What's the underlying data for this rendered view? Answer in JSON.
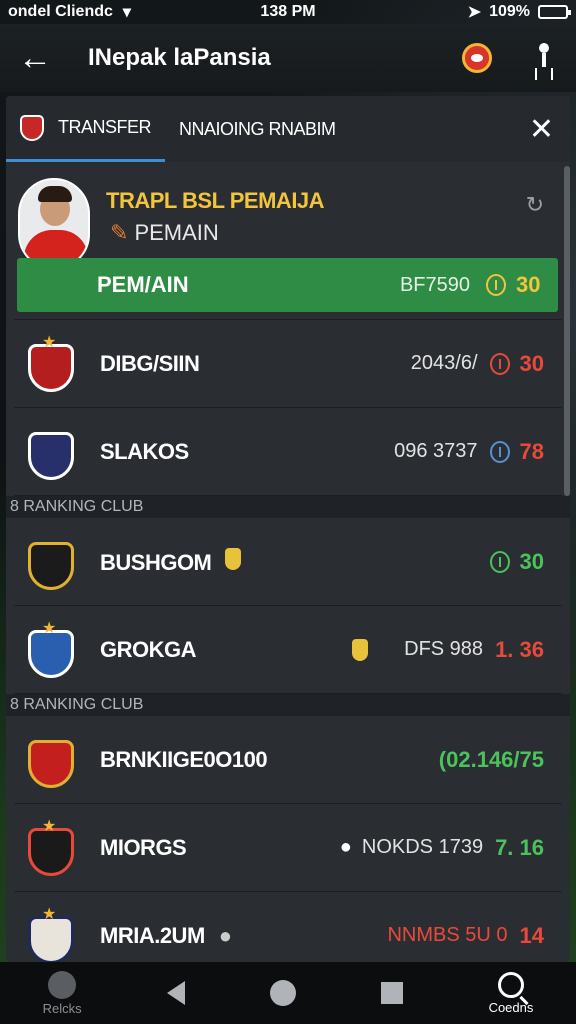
{
  "status": {
    "carrier": "ondel Cliendc",
    "time": "138 PM",
    "battery": "109%"
  },
  "appbar": {
    "title": "INepak laPansia"
  },
  "tabs": [
    {
      "label": "TRANSFER"
    },
    {
      "label": "NNAIOING RNABIM"
    }
  ],
  "profile": {
    "title": "TRAPL BSL PEMAIJA",
    "subtitle": "PEMAIN",
    "highlight": {
      "name": "PEM/AIN",
      "code": "BF7590",
      "value": "30"
    }
  },
  "rows_top": [
    {
      "name": "DIBG/SIIN",
      "code": "2043/6/",
      "value": "30",
      "color": "#e84a3a"
    },
    {
      "name": "SLAKOS",
      "code": "096 3737",
      "value": "78",
      "color": "#e84a3a"
    }
  ],
  "section1": "8 RANKING CLUB",
  "rows_mid": [
    {
      "name": "BUSHGOM",
      "code": "",
      "value": "30",
      "color": "#4cc35a"
    },
    {
      "name": "GROKGA",
      "code": "DFS 988",
      "value": "1. 36",
      "color": "#e84a3a"
    }
  ],
  "section2": "8 RANKING CLUB",
  "rows_bottom": [
    {
      "name": "BRNKIIGE0O100",
      "code": "",
      "value": "(02.146/75",
      "color": "#4cc35a"
    },
    {
      "name": "MIORGS",
      "code": "NOKDS 1739",
      "value": "7. 16",
      "color": "#4cc35a"
    },
    {
      "name": "MRIA.2UM",
      "code": "NNMBS 5U 0",
      "value": "14",
      "color": "#e84a3a"
    }
  ],
  "navbar": {
    "left_label": "Relcks",
    "right_label": "Coedns"
  }
}
